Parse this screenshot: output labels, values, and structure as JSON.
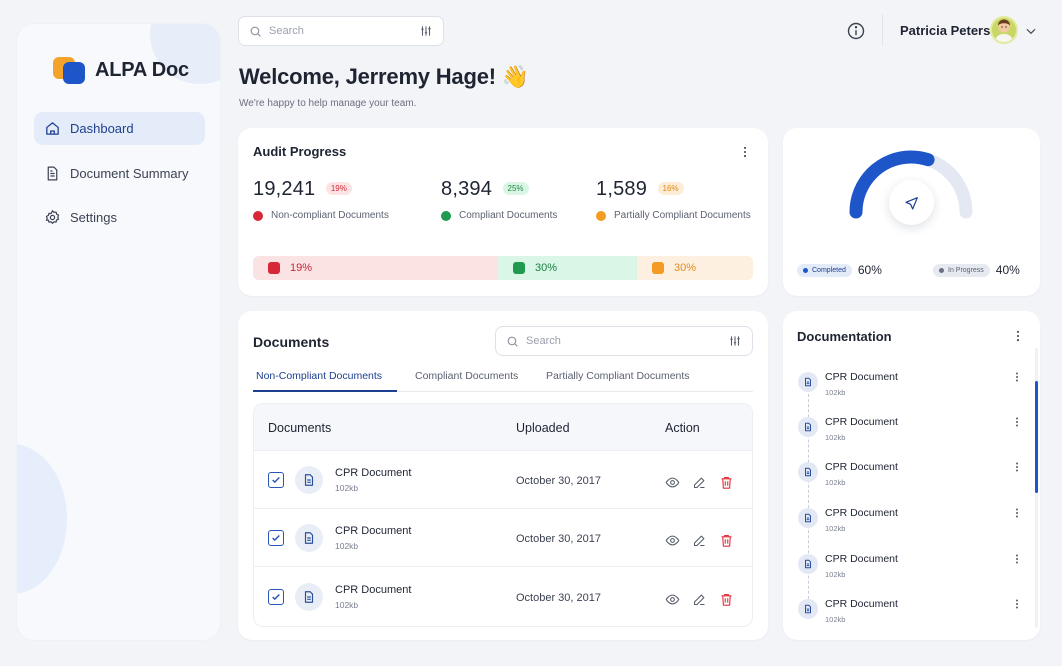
{
  "app": {
    "name": "ALPA Doc"
  },
  "sidebar": {
    "items": [
      {
        "label": "Dashboard",
        "icon": "home-icon",
        "active": true
      },
      {
        "label": "Document Summary",
        "icon": "document-icon",
        "active": false
      },
      {
        "label": "Settings",
        "icon": "gear-icon",
        "active": false
      }
    ]
  },
  "topbar": {
    "search_placeholder": "Search",
    "user_name": "Patricia Peters"
  },
  "header": {
    "welcome": "Welcome, Jerremy Hage! 👋",
    "subtitle": "We're happy to help manage your team."
  },
  "audit": {
    "title": "Audit Progress",
    "stats": [
      {
        "value": "19,241",
        "badge": "19%",
        "label": "Non-compliant Documents",
        "color": "#d7283a"
      },
      {
        "value": "8,394",
        "badge": "25%",
        "label": "Compliant Documents",
        "color": "#1f9a4f"
      },
      {
        "value": "1,589",
        "badge": "16%",
        "label": "Partially Compliant Documents",
        "color": "#f39b22"
      }
    ],
    "bar": [
      {
        "label": "19%",
        "value": 19,
        "bg": "#fbe3e3",
        "fg": "#d7283a",
        "text": "#c8283a"
      },
      {
        "label": "30%",
        "value": 30,
        "bg": "#d9f6e6",
        "fg": "#1f9a4f",
        "text": "#1b7f43"
      },
      {
        "label": "30%",
        "value": 30,
        "bg": "#fdf0e0",
        "fg": "#f39b22",
        "text": "#e68a17"
      }
    ]
  },
  "gauge": {
    "completed_label": "Completed",
    "completed_value": "60%",
    "completed_fraction": 0.6,
    "in_progress_label": "In Progress",
    "in_progress_value": "40%",
    "colors": {
      "completed": "#1e56c9",
      "in_progress": "#e3e8f2"
    }
  },
  "documents": {
    "title": "Documents",
    "search_placeholder": "Search",
    "tabs": [
      {
        "label": "Non-Compliant Documents",
        "active": true
      },
      {
        "label": "Compliant Documents",
        "active": false
      },
      {
        "label": "Partially Compliant Documents",
        "active": false
      }
    ],
    "columns": {
      "documents": "Documents",
      "uploaded": "Uploaded",
      "action": "Action"
    },
    "rows": [
      {
        "name": "CPR Document",
        "size": "102kb",
        "uploaded": "October 30, 2017",
        "checked": true
      },
      {
        "name": "CPR Document",
        "size": "102kb",
        "uploaded": "October 30, 2017",
        "checked": true
      },
      {
        "name": "CPR Document",
        "size": "102kb",
        "uploaded": "October 30, 2017",
        "checked": true
      }
    ]
  },
  "documentation": {
    "title": "Documentation",
    "items": [
      {
        "name": "CPR Document",
        "size": "102kb"
      },
      {
        "name": "CPR Document",
        "size": "102kb"
      },
      {
        "name": "CPR Document",
        "size": "102kb"
      },
      {
        "name": "CPR Document",
        "size": "102kb"
      },
      {
        "name": "CPR Document",
        "size": "102kb"
      },
      {
        "name": "CPR Document",
        "size": "102kb"
      }
    ]
  }
}
